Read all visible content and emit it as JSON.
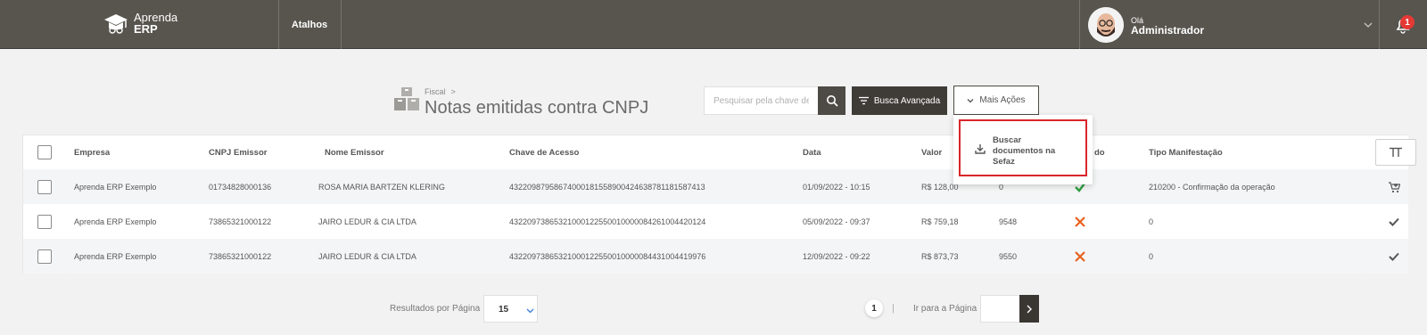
{
  "app": {
    "logo_line1": "Aprenda",
    "logo_line2": "ERP"
  },
  "topbar": {
    "shortcuts_label": "Atalhos",
    "greeting": "Olá",
    "user_name": "Administrador",
    "notification_count": "1"
  },
  "page": {
    "breadcrumb": "Fiscal",
    "breadcrumb_sep": ">",
    "title": "Notas emitidas contra CNPJ"
  },
  "toolbar": {
    "search_placeholder": "Pesquisar pela chave de",
    "advanced_search_label": "Busca Avançada",
    "more_actions_label": "Mais Ações"
  },
  "dropdown": {
    "items": [
      {
        "label": "Buscar documentos na Sefaz",
        "icon": "download-icon"
      }
    ]
  },
  "table": {
    "headers": {
      "empresa": "Empresa",
      "cnpj": "CNPJ Emissor",
      "nome": "Nome Emissor",
      "chave": "Chave de Acesso",
      "data": "Data",
      "valor": "Valor",
      "status_partial": "do",
      "manifest": "Tipo Manifestação"
    },
    "rows": [
      {
        "empresa": "Aprenda ERP Exemplo",
        "cnpj": "01734828000136",
        "nome": "ROSA MARIA BARTZEN KLERING",
        "chave": "43220987958674000181558900424638781181587413",
        "data": "01/09/2022 - 10:15",
        "valor": "R$ 128,00",
        "numero": "0",
        "status": "check",
        "status_color": "#2e9e3f",
        "manifest": "210200 - Confirmação da operação",
        "action_icon": "cart-icon"
      },
      {
        "empresa": "Aprenda ERP Exemplo",
        "cnpj": "73865321000122",
        "nome": "JAIRO LEDUR & CIA LTDA",
        "chave": "43220973865321000122550010000084261004420124",
        "data": "05/09/2022 - 09:37",
        "valor": "R$ 759,18",
        "numero": "9548",
        "status": "x",
        "status_color": "#e8601c",
        "manifest": "0",
        "action_icon": "check-icon"
      },
      {
        "empresa": "Aprenda ERP Exemplo",
        "cnpj": "73865321000122",
        "nome": "JAIRO LEDUR & CIA LTDA",
        "chave": "43220973865321000122550010000084431004419976",
        "data": "12/09/2022 - 09:22",
        "valor": "R$ 873,73",
        "numero": "9550",
        "status": "x",
        "status_color": "#e8601c",
        "manifest": "0",
        "action_icon": "check-icon"
      }
    ]
  },
  "pagination": {
    "results_per_page_label": "Resultados por Página",
    "results_per_page_value": "15",
    "current_page": "1",
    "separator": "|",
    "goto_label": "Ir para a Página"
  },
  "colors": {
    "topbar": "#58554f",
    "accent_dark": "#3f3c38",
    "highlight_red": "#d9262b",
    "badge_red": "#e53935"
  }
}
